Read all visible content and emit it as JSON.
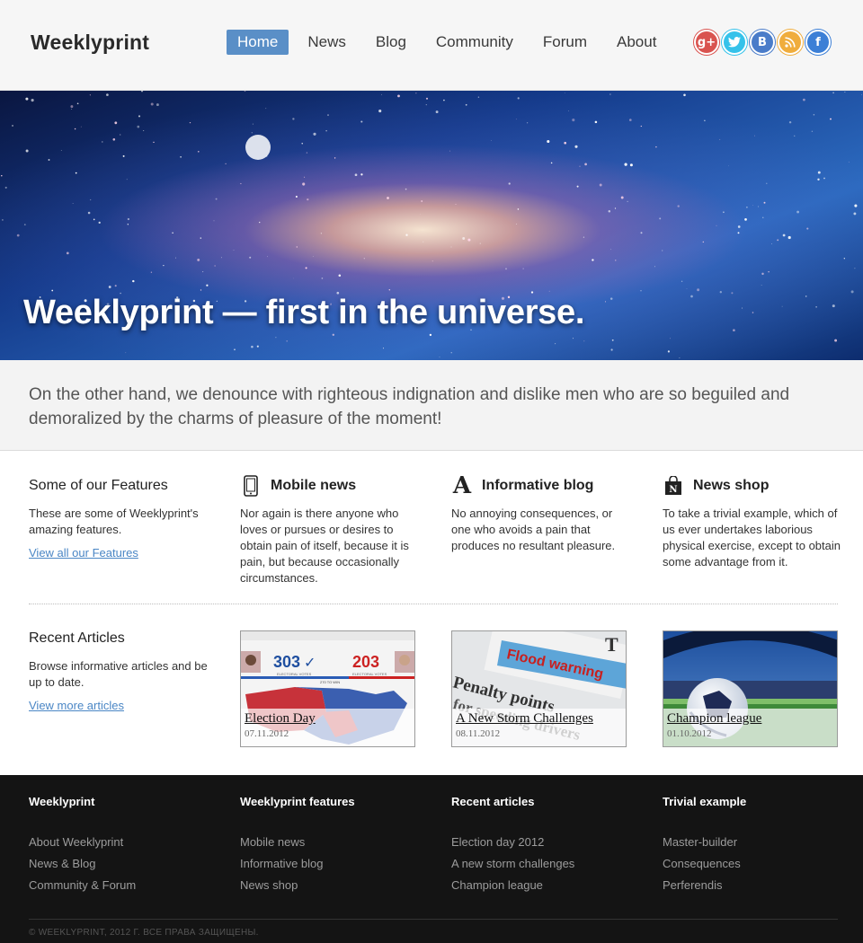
{
  "header": {
    "logo": "Weeklyprint",
    "nav": [
      {
        "label": "Home",
        "active": true
      },
      {
        "label": "News"
      },
      {
        "label": "Blog"
      },
      {
        "label": "Community"
      },
      {
        "label": "Forum"
      },
      {
        "label": "About"
      }
    ],
    "social": [
      {
        "icon": "google-plus-icon",
        "glyph": "g+",
        "color": "#d9534f"
      },
      {
        "icon": "twitter-icon",
        "glyph": "t",
        "color": "#35c2ea"
      },
      {
        "icon": "vk-icon",
        "glyph": "B",
        "color": "#4a7cc9"
      },
      {
        "icon": "rss-icon",
        "glyph": "◉",
        "color": "#f0ad3d"
      },
      {
        "icon": "facebook-icon",
        "glyph": "f",
        "color": "#3c7fd6"
      }
    ]
  },
  "hero": {
    "title": "Weeklyprint — first in the universe."
  },
  "intro": {
    "text": "On the other hand, we denounce with righteous indignation and dislike men who are so beguiled and demoralized by the charms of pleasure of the moment!"
  },
  "features": {
    "title": "Some of our Features",
    "text": "These are some of Weeklyprint's amazing features.",
    "link": "View all our Features",
    "items": [
      {
        "icon": "phone-icon",
        "title": "Mobile news",
        "text": "Nor again is there anyone who loves or pursues or desires to obtain pain of itself, because it is pain, but because occasionally circumstances."
      },
      {
        "icon": "letter-a-icon",
        "title": "Informative blog",
        "text": "No annoying consequences, or one who avoids a pain that produces no resultant pleasure."
      },
      {
        "icon": "shopping-bag-icon",
        "title": "News shop",
        "text": "To take a trivial example, which of us ever undertakes laborious physical exercise, except to obtain some advantage from it."
      }
    ]
  },
  "articles": {
    "title": "Recent Articles",
    "text": "Browse informative articles and be up to date.",
    "link": "View more articles",
    "items": [
      {
        "title": "Election Day",
        "date": "07.11.2012",
        "left_votes": "303",
        "right_votes": "203",
        "left_label": "ELECTORAL VOTES",
        "right_label": "ELECTORAL VOTES",
        "center_label": "270 TO WIN"
      },
      {
        "title": "A New Storm Challenges",
        "date": "08.11.2012",
        "headline": "Flood warning",
        "subtext": "Penalty points ... speeding drivers"
      },
      {
        "title": "Champion league",
        "date": "01.10.2012"
      }
    ]
  },
  "footer": {
    "columns": [
      {
        "title": "Weeklyprint",
        "links": [
          "About Weeklyprint",
          "News & Blog",
          "Community & Forum"
        ]
      },
      {
        "title": "Weeklyprint features",
        "links": [
          "Mobile news",
          "Informative blog",
          "News shop"
        ]
      },
      {
        "title": "Recent articles",
        "links": [
          "Election day 2012",
          "A new storm challenges",
          "Champion league"
        ]
      },
      {
        "title": "Trivial example",
        "links": [
          "Master-builder",
          "Consequences",
          "Perferendis"
        ]
      }
    ],
    "copyright": "© WEEKLYPRINT, 2012 Г. ВСЕ ПРАВА ЗАЩИЩЕНЫ."
  }
}
